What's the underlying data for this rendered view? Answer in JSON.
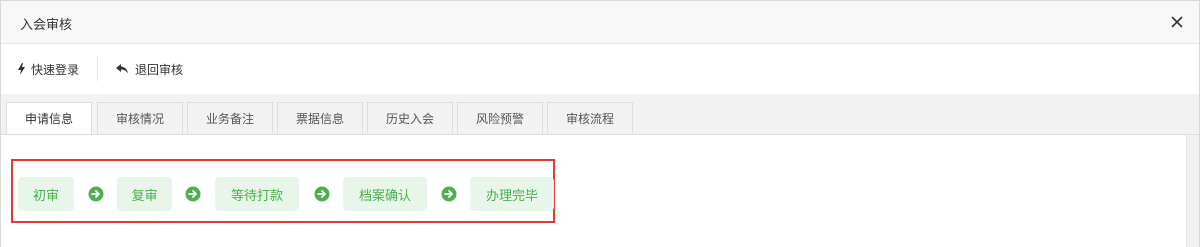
{
  "dialog": {
    "title": "入会审核"
  },
  "toolbar": {
    "quick_login_label": "快速登录",
    "return_review_label": "退回审核"
  },
  "tabs": [
    {
      "label": "申请信息",
      "active": true
    },
    {
      "label": "审核情况",
      "active": false
    },
    {
      "label": "业务备注",
      "active": false
    },
    {
      "label": "票据信息",
      "active": false
    },
    {
      "label": "历史入会",
      "active": false
    },
    {
      "label": "风险预警",
      "active": false
    },
    {
      "label": "审核流程",
      "active": false
    }
  ],
  "flow": {
    "steps": [
      "初审",
      "复审",
      "等待打款",
      "档案确认",
      "办理完毕"
    ],
    "highlight_color": "#e53935",
    "step_color": "#4caf50",
    "step_bg": "#e8f5e9"
  }
}
